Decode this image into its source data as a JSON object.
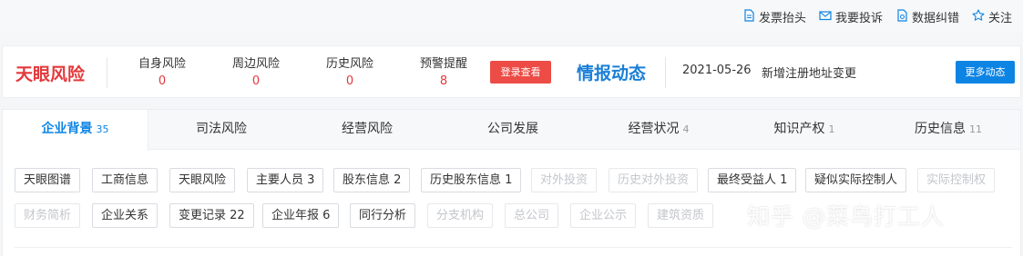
{
  "top_actions": [
    {
      "label": "发票抬头",
      "icon": "invoice-doc-icon"
    },
    {
      "label": "我要投诉",
      "icon": "mail-icon"
    },
    {
      "label": "数据纠错",
      "icon": "document-correct-icon"
    },
    {
      "label": "关注",
      "icon": "star-icon"
    }
  ],
  "risk": {
    "logo": "天眼风险",
    "items": [
      {
        "label": "自身风险",
        "count": "0"
      },
      {
        "label": "周边风险",
        "count": "0"
      },
      {
        "label": "历史风险",
        "count": "0"
      },
      {
        "label": "预警提醒",
        "count": "8"
      }
    ],
    "login_button": "登录查看"
  },
  "intel": {
    "title": "情报动态",
    "date": "2021-05-26",
    "text": "新增注册地址变更",
    "more_button": "更多动态"
  },
  "tabs": [
    {
      "label": "企业背景",
      "count": "35"
    },
    {
      "label": "司法风险",
      "count": ""
    },
    {
      "label": "经营风险",
      "count": ""
    },
    {
      "label": "公司发展",
      "count": ""
    },
    {
      "label": "经营状况",
      "count": "4"
    },
    {
      "label": "知识产权",
      "count": "1"
    },
    {
      "label": "历史信息",
      "count": "11"
    }
  ],
  "chips_row1": [
    {
      "label": "天眼图谱"
    },
    {
      "label": "工商信息"
    },
    {
      "label": "天眼风险"
    },
    {
      "label": "主要人员 3"
    },
    {
      "label": "股东信息 2"
    },
    {
      "label": "历史股东信息 1"
    },
    {
      "label": "对外投资"
    },
    {
      "label": "历史对外投资"
    },
    {
      "label": "最终受益人 1"
    },
    {
      "label": "疑似实际控制人"
    },
    {
      "label": "实际控制权"
    }
  ],
  "chips_row2": [
    {
      "label": "财务简析"
    },
    {
      "label": "企业关系"
    },
    {
      "label": "变更记录 22"
    },
    {
      "label": "企业年报 6"
    },
    {
      "label": "同行分析"
    },
    {
      "label": "分支机构"
    },
    {
      "label": "总公司"
    },
    {
      "label": "企业公示"
    },
    {
      "label": "建筑资质"
    }
  ],
  "watermark": "知乎 @菜鸟打工人",
  "colors": {
    "brand_red": "#e4393c",
    "brand_blue": "#0c84e4",
    "disabled": "#c3c6cb"
  }
}
